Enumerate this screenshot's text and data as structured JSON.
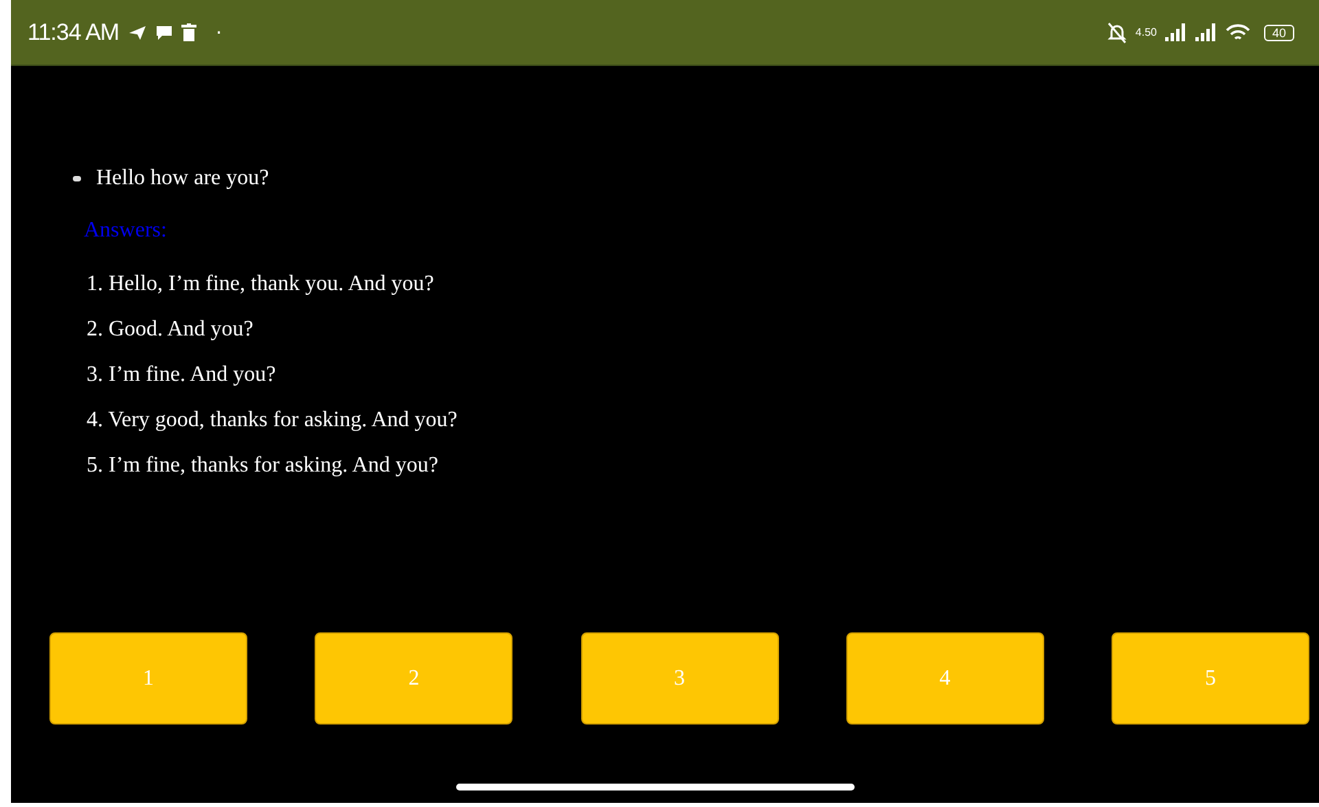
{
  "status_bar": {
    "time": "11:34 AM",
    "dot": "·",
    "net_speed": "4.50",
    "battery": "40"
  },
  "question": "Hello how are you?",
  "answers_label": "Answers:",
  "answers": [
    "1. Hello, I’m fine, thank you. And you?",
    "2. Good. And you?",
    "3. I’m fine. And you?",
    "4. Very good, thanks for asking. And you?",
    "5. I’m fine, thanks for asking. And you?"
  ],
  "buttons": [
    "1",
    "2",
    "3",
    "4",
    "5"
  ]
}
